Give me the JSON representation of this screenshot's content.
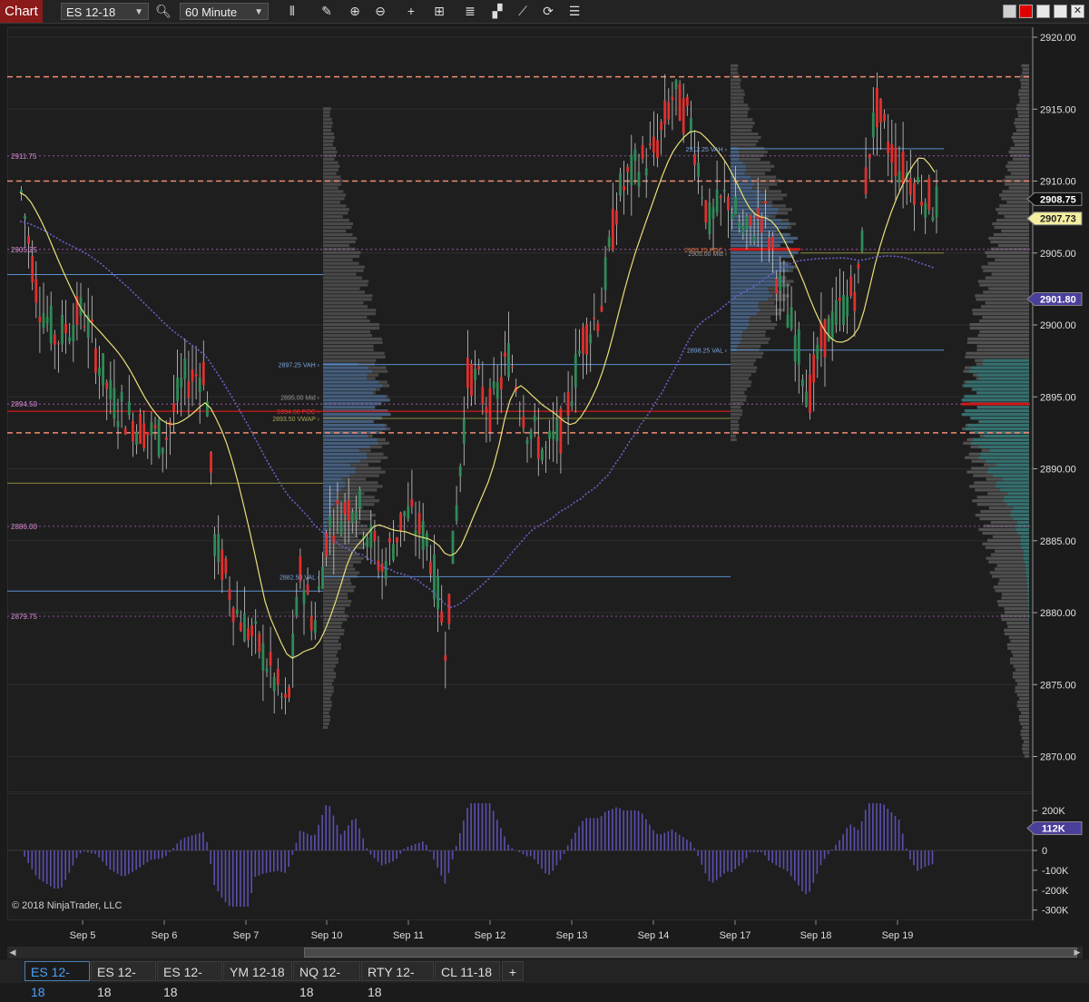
{
  "toolbar": {
    "title": "Chart",
    "instrument": "ES 12-18",
    "interval": "60 Minute",
    "icons": [
      "bars-type-icon",
      "pencil-icon",
      "zoom-in-icon",
      "zoom-out-icon",
      "crosshair-icon",
      "data-box-icon",
      "indicators-icon",
      "strategies-icon",
      "drawing-tools-icon",
      "refresh-icon",
      "properties-icon"
    ]
  },
  "colors": {
    "up_candle": "#2e8b57",
    "down_candle": "#e0302e",
    "background": "#1e1e1e",
    "profile_blue": "#3f6fa8",
    "profile_teal": "#1f8a8a",
    "vwap_yellow": "#e8e07a",
    "dotted_blue": "#6a5fc7",
    "osc_bar": "#5b4fb0",
    "dash_line": "#f08a72"
  },
  "price_axis": {
    "ticks": [
      "2920.00",
      "2915.00",
      "2910.00",
      "2905.00",
      "2900.00",
      "2895.00",
      "2890.00",
      "2885.00",
      "2880.00",
      "2875.00",
      "2870.00"
    ],
    "last_price": "2908.75",
    "ma_price": "2907.73",
    "vwap_price": "2901.80"
  },
  "osc_axis": {
    "ticks": [
      "200K",
      "100K",
      "0",
      "-100K",
      "-200K",
      "-300K"
    ],
    "current": "112K"
  },
  "time_axis": [
    "Sep 5",
    "Sep 6",
    "Sep 7",
    "Sep 10",
    "Sep 11",
    "Sep 12",
    "Sep 13",
    "Sep 14",
    "Sep 17",
    "Sep 18",
    "Sep 19"
  ],
  "level_labels": {
    "l1": "2911.75",
    "l2": "2905.25",
    "l3": "2894.50",
    "l4": "2886.00",
    "l5": "2879.75"
  },
  "profile_labels": {
    "vah1": "2897.25 VAH",
    "mid1": "2895.00 Mid",
    "poc1": "2894.00 POC",
    "vwap1": "2893.50 VWAP",
    "val1": "2882.50 VAL",
    "vah2": "2912.25 VAH",
    "poc2": "2905.25 POC",
    "mid2": "2905.00 Mid",
    "val2": "2898.25 VAL"
  },
  "copyright": "© 2018 NinjaTrader, LLC",
  "tabs": [
    "ES 12-18",
    "ES 12-18",
    "ES 12-18",
    "YM 12-18",
    "NQ 12-18",
    "RTY 12-18",
    "CL 11-18"
  ],
  "add_tab": "+"
}
